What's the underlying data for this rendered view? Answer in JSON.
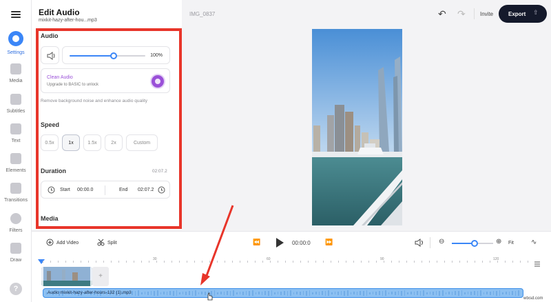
{
  "sidebar": {
    "items": [
      {
        "label": "Settings",
        "icon": "settings-icon",
        "active": true
      },
      {
        "label": "Media",
        "icon": "media-icon"
      },
      {
        "label": "Subtitles",
        "icon": "subtitles-icon"
      },
      {
        "label": "Text",
        "icon": "text-icon"
      },
      {
        "label": "Elements",
        "icon": "elements-icon"
      },
      {
        "label": "Transitions",
        "icon": "transitions-icon"
      },
      {
        "label": "Filters",
        "icon": "filters-icon"
      },
      {
        "label": "Draw",
        "icon": "draw-icon"
      }
    ],
    "help": "?"
  },
  "panel": {
    "title": "Edit Audio",
    "subtitle": "mixkit-hazy-after-hou...mp3",
    "audio": {
      "heading": "Audio",
      "volume": 1.0,
      "volume_label": "100%",
      "clean_title": "Clean Audio",
      "clean_sub": "Upgrade to BASIC to unlock",
      "clean_desc": "Remove background noise and enhance audio quality"
    },
    "speed": {
      "heading": "Speed",
      "options": [
        "0.5x",
        "1x",
        "1.5x",
        "2x",
        "Custom"
      ],
      "selected": "1x"
    },
    "duration": {
      "heading": "Duration",
      "total": "02:07.2",
      "start_label": "Start",
      "start_value": "00:00.0",
      "end_label": "End",
      "end_value": "02:07.2"
    },
    "media_heading": "Media"
  },
  "header": {
    "file_name": "IMG_0837",
    "invite": "Invite",
    "export": "Export"
  },
  "controls": {
    "add_video": "Add Video",
    "split": "Split",
    "time": "00:00:0",
    "zoom": 0.55,
    "fit": "Fit"
  },
  "timeline": {
    "ruler_labels": [
      "30",
      "60",
      "90",
      "120"
    ],
    "audio_clip_label": "Audio mixkit-hazy-after-hours-132 (1).mp3"
  },
  "watermark": "wtxsd.com",
  "colors": {
    "accent": "#3b86f7",
    "highlight": "#e8352a",
    "export_bg": "#14192b",
    "clean_audio": "#9a50d8"
  }
}
